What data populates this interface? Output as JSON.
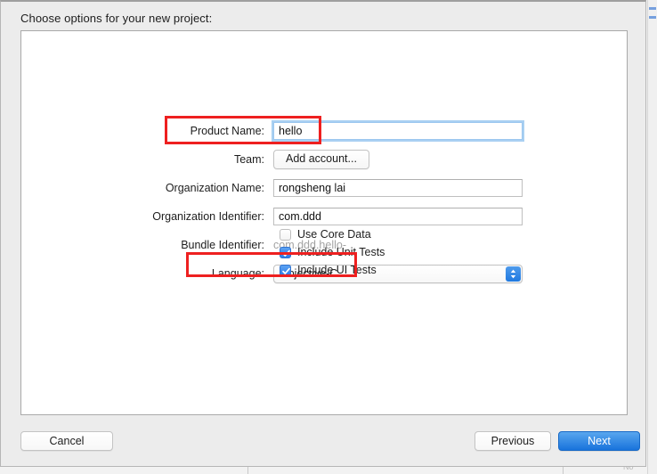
{
  "dialog": {
    "title": "Choose options for your new project:"
  },
  "form": {
    "rows": [
      {
        "label": "Product Name:",
        "value": "hello",
        "control": "text-field-focused"
      },
      {
        "label": "Team:",
        "value": "Add account...",
        "control": "push-button"
      },
      {
        "label": "Organization Name:",
        "value": "rongsheng lai",
        "control": "text-field"
      },
      {
        "label": "Organization Identifier:",
        "value": "com.ddd",
        "control": "text-field"
      },
      {
        "label": "Bundle Identifier:",
        "value": "com.ddd.hello-",
        "control": "static-text"
      },
      {
        "label": "Language:",
        "value": "Objective-C",
        "control": "popup-button"
      }
    ]
  },
  "checkboxes": [
    {
      "label": "Use Core Data",
      "checked": false
    },
    {
      "label": "Include Unit Tests",
      "checked": true
    },
    {
      "label": "Include UI Tests",
      "checked": true
    }
  ],
  "buttons": {
    "cancel": "Cancel",
    "previous": "Previous",
    "next": "Next"
  },
  "annotations": [
    {
      "name": "product-name-highlight",
      "color": "#ee2020"
    },
    {
      "name": "language-highlight",
      "color": "#ee2020"
    }
  ],
  "colors": {
    "accent_blue": "#1873dc",
    "annotation_red": "#ee2020",
    "focus_ring": "#a9d0f2",
    "checkbox_blue": "#2f7de8",
    "dialog_background": "#ececec",
    "panel_background": "#ffffff"
  }
}
